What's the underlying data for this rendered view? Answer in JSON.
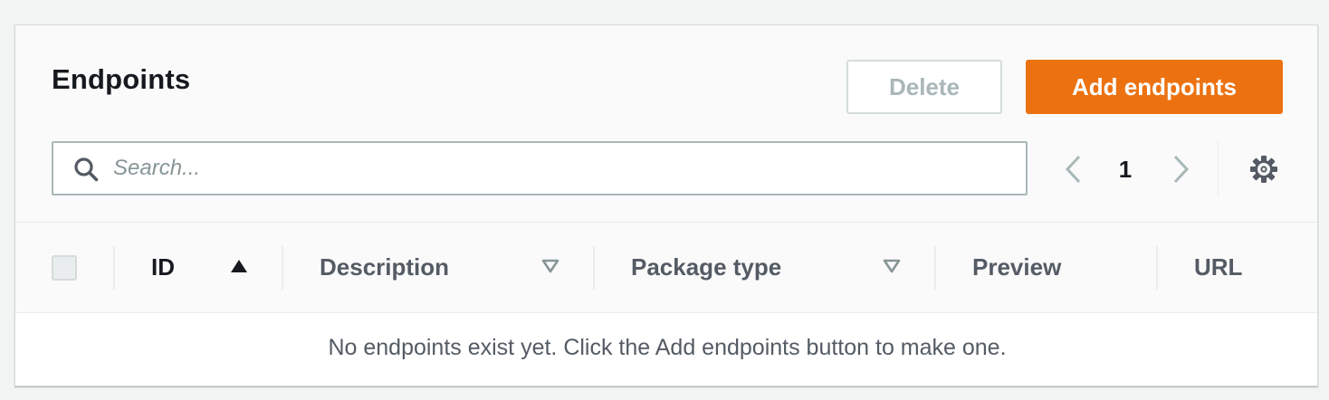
{
  "panel": {
    "title": "Endpoints",
    "delete_label": "Delete",
    "add_label": "Add endpoints"
  },
  "search": {
    "placeholder": "Search...",
    "value": ""
  },
  "pagination": {
    "current_page": "1"
  },
  "table": {
    "columns": [
      {
        "label": "ID",
        "sort": "ascending"
      },
      {
        "label": "Description",
        "sort": "sortable"
      },
      {
        "label": "Package type",
        "sort": "sortable"
      },
      {
        "label": "Preview",
        "sort": "none"
      },
      {
        "label": "URL",
        "sort": "none"
      }
    ],
    "rows": [],
    "empty_message": "No endpoints exist yet. Click the Add endpoints button to make one."
  },
  "colors": {
    "accent": "#ec7211",
    "text_primary": "#16191f",
    "text_secondary": "#545b64",
    "border": "#aab7b8",
    "background": "#f2f3f3"
  },
  "icons": {
    "search": "search-icon",
    "prev": "chevron-left-icon",
    "next": "chevron-right-icon",
    "settings": "gear-icon",
    "sort_asc": "sort-ascending-icon",
    "sort_neutral": "sort-neutral-icon"
  }
}
